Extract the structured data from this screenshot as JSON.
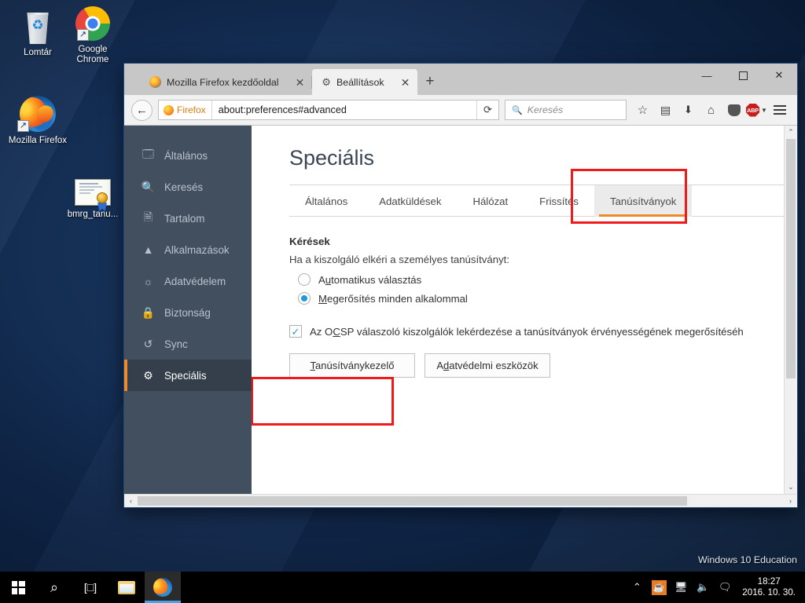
{
  "desktop": {
    "icons": [
      {
        "label": "Lomtár",
        "icon": "recycle-bin-icon"
      },
      {
        "label": "Google Chrome",
        "icon": "chrome-icon"
      },
      {
        "label": "Mozilla Firefox",
        "icon": "firefox-icon"
      },
      {
        "label": "bmrg_tanu...",
        "icon": "certificate-file-icon"
      }
    ],
    "watermark": "Windows 10 Education"
  },
  "browser": {
    "tabs": [
      {
        "title": "Mozilla Firefox kezdőoldal",
        "icon": "firefox-favicon",
        "close": "✕",
        "active": false
      },
      {
        "title": "Beállítások",
        "icon": "gear-favicon",
        "close": "✕",
        "active": true
      }
    ],
    "new_tab_label": "+",
    "window_controls": {
      "minimize": "—",
      "maximize": "❐",
      "close": "✕"
    },
    "nav": {
      "back": "←",
      "identity_label": "Firefox",
      "url": "about:preferences#advanced",
      "reload": "⟳",
      "search_placeholder": "Keresés",
      "search_value": ""
    },
    "toolbar_icons": [
      {
        "name": "bookmark-star-icon",
        "glyph": "☆"
      },
      {
        "name": "library-icon",
        "glyph": "▤"
      },
      {
        "name": "downloads-icon",
        "glyph": "⬇"
      },
      {
        "name": "home-icon",
        "glyph": "⌂"
      },
      {
        "name": "pocket-icon",
        "glyph": "▼"
      },
      {
        "name": "adblock-plus-icon",
        "glyph": "ABP"
      },
      {
        "name": "menu-icon",
        "glyph": "≡"
      }
    ]
  },
  "prefs": {
    "sidebar": [
      {
        "label": "Általános",
        "icon": "general-icon",
        "selected": false
      },
      {
        "label": "Keresés",
        "icon": "search-icon",
        "selected": false
      },
      {
        "label": "Tartalom",
        "icon": "content-icon",
        "selected": false
      },
      {
        "label": "Alkalmazások",
        "icon": "applications-icon",
        "selected": false
      },
      {
        "label": "Adatvédelem",
        "icon": "privacy-mask-icon",
        "selected": false
      },
      {
        "label": "Biztonság",
        "icon": "security-lock-icon",
        "selected": false
      },
      {
        "label": "Sync",
        "icon": "sync-icon",
        "selected": false
      },
      {
        "label": "Speciális",
        "icon": "advanced-icon",
        "selected": true
      }
    ],
    "title": "Speciális",
    "tabs": [
      {
        "label": "Általános",
        "selected": false
      },
      {
        "label": "Adatküldések",
        "selected": false
      },
      {
        "label": "Hálózat",
        "selected": false
      },
      {
        "label": "Frissítés",
        "selected": false
      },
      {
        "label": "Tanúsítványok",
        "selected": true
      }
    ],
    "section_title": "Kérések",
    "section_desc": "Ha a kiszolgáló elkéri a személyes tanúsítványt:",
    "radios": [
      {
        "label_pre": "A",
        "label_key": "u",
        "label_post": "tomatikus választás",
        "checked": false
      },
      {
        "label_pre": "",
        "label_key": "M",
        "label_post": "egerősítés minden alkalommal",
        "checked": true
      }
    ],
    "ocsp": {
      "checked": true,
      "check_glyph": "✓",
      "label_pre": "Az O",
      "label_key": "C",
      "label_post": "SP válaszoló kiszolgálók lekérdezése a tanúsítványok érvényességének megerősítéséh"
    },
    "buttons": [
      {
        "pre": "",
        "key": "T",
        "post": "anúsítványkezelő",
        "annotated": true
      },
      {
        "pre": "A",
        "key": "d",
        "post": "atvédelmi eszközök",
        "annotated": false
      }
    ],
    "accent_color": "#f0892a",
    "sidebar_bg": "#424f5e",
    "annotation_color": "#f01a1a"
  },
  "scrollbars": {
    "v_up": "⌃",
    "v_down": "⌄",
    "h_left": "‹",
    "h_right": "›"
  },
  "taskbar": {
    "start": "start-button",
    "search": "⌕",
    "taskview": "taskview-icon",
    "explorer": "file-explorer-icon",
    "firefox": "firefox-taskbar-icon",
    "tray": [
      {
        "name": "show-hidden-icons",
        "glyph": "⌃"
      },
      {
        "name": "java-icon",
        "glyph": "☕"
      },
      {
        "name": "network-icon",
        "glyph": "🖳"
      },
      {
        "name": "volume-icon",
        "glyph": "🔊"
      },
      {
        "name": "action-center-icon",
        "glyph": "🗨"
      }
    ],
    "time": "18:27",
    "date": "2016. 10. 30."
  }
}
